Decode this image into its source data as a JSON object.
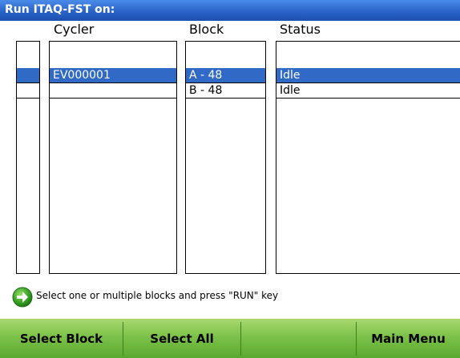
{
  "title": "Run ITAQ-FST on:",
  "columns": {
    "cycler": "Cycler",
    "block": "Block",
    "status": "Status"
  },
  "rows": [
    {
      "cycler": "EV000001",
      "block": "A - 48",
      "status": "Idle",
      "selected": true
    },
    {
      "cycler": "",
      "block": "B - 48",
      "status": "Idle",
      "selected": false
    }
  ],
  "hint": {
    "icon": "green-arrow-right-icon",
    "text": "Select one or multiple blocks and press \"RUN\" key"
  },
  "softkeys": {
    "select_block": "Select Block",
    "select_all": "Select All",
    "empty": "",
    "main_menu": "Main Menu"
  },
  "colors": {
    "title_bar": "#2a64c8",
    "selection": "#3169c6",
    "softkey_bar": "#7cc24a"
  }
}
